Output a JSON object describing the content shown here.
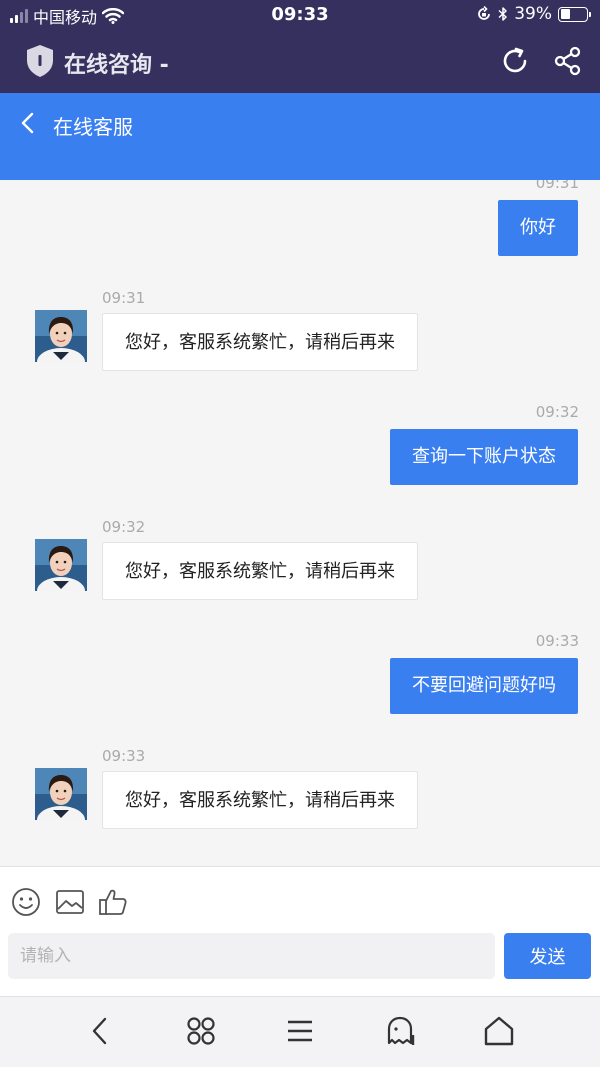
{
  "status_bar": {
    "carrier": "中国移动",
    "time": "09:33",
    "battery_percent": "39%",
    "battery_level": 0.39
  },
  "app_bar": {
    "title": "在线咨询 -",
    "icons": [
      "shield-icon",
      "refresh-icon",
      "share-icon"
    ]
  },
  "chat_header": {
    "title": "在线客服"
  },
  "messages": [
    {
      "direction": "out",
      "time": "09:31",
      "text": "你好"
    },
    {
      "direction": "in",
      "time": "09:31",
      "text": "您好，客服系统繁忙，请稍后再来"
    },
    {
      "direction": "out",
      "time": "09:32",
      "text": "查询一下账户状态"
    },
    {
      "direction": "in",
      "time": "09:32",
      "text": "您好，客服系统繁忙，请稍后再来"
    },
    {
      "direction": "out",
      "time": "09:33",
      "text": "不要回避问题好吗"
    },
    {
      "direction": "in",
      "time": "09:33",
      "text": "您好，客服系统繁忙，请稍后再来"
    }
  ],
  "composer": {
    "placeholder": "请输入",
    "value": "",
    "send_label": "发送",
    "tools": [
      "emoji-icon",
      "image-icon",
      "thumbs-up-icon"
    ]
  },
  "bottom_nav": [
    "back-icon",
    "apps-icon",
    "menu-icon",
    "ghost-icon",
    "home-icon"
  ],
  "colors": {
    "header_bg": "#36305f",
    "accent": "#3a7ff0",
    "chat_bg": "#f5f5f5"
  }
}
